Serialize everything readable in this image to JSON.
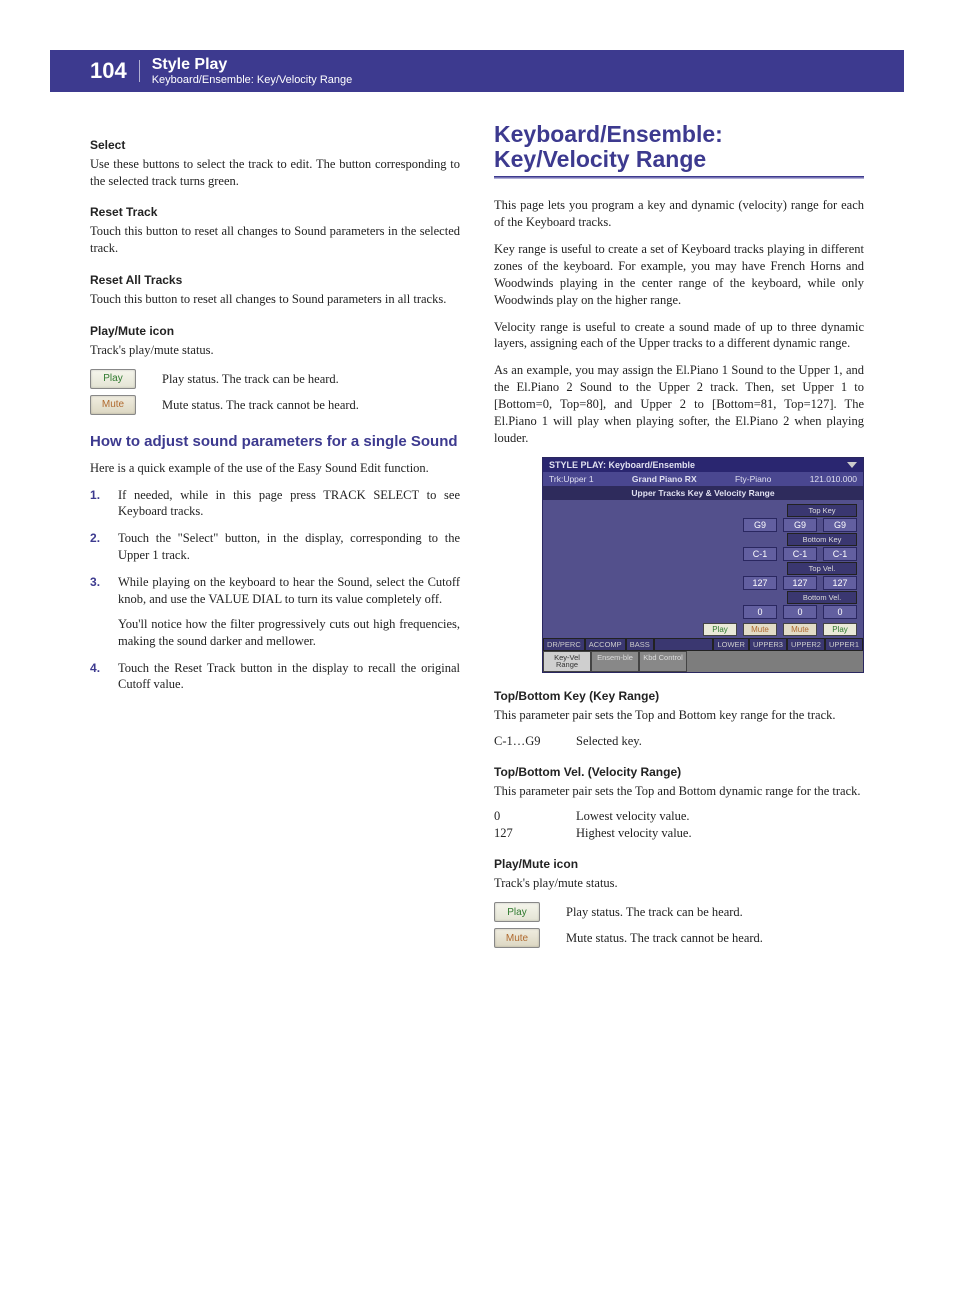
{
  "header": {
    "page_number": "104",
    "title": "Style Play",
    "subtitle": "Keyboard/Ensemble: Key/Velocity Range"
  },
  "left": {
    "select_head": "Select",
    "select_body": "Use these buttons to select the track to edit. The button corresponding to the selected track turns green.",
    "reset_track_head": "Reset Track",
    "reset_track_body": "Touch this button to reset all changes to Sound parameters in the selected track.",
    "reset_all_head": "Reset All Tracks",
    "reset_all_body": "Touch this button to reset all changes to Sound parameters in all tracks.",
    "pm_head": "Play/Mute icon",
    "pm_body": "Track's play/mute status.",
    "play_label": "Play",
    "play_desc": "Play status. The track can be heard.",
    "mute_label": "Mute",
    "mute_desc": "Mute status. The track cannot be heard.",
    "howto_head": "How to adjust sound parameters for a single Sound",
    "howto_intro": "Here is a quick example of the use of the Easy Sound Edit function.",
    "steps": [
      "If needed, while in this page press TRACK SELECT to see Keyboard tracks.",
      "Touch the \"Select\" button, in the display, corresponding to the Upper 1 track.",
      "While playing on the keyboard to hear the Sound, select the Cutoff knob, and use the VALUE DIAL to turn its value completely off.",
      "Touch the Reset Track button in the display to recall the original Cutoff value."
    ],
    "step3_sub": "You'll notice how the filter progressively cuts out high frequencies, making the sound darker and mellower."
  },
  "right": {
    "title": "Keyboard/Ensemble: Key/Velocity Range",
    "p1": "This page lets you program a key and dynamic (velocity) range for each of the Keyboard tracks.",
    "p2": "Key range is useful to create a set of Keyboard tracks playing in different zones of the keyboard. For example, you may have French Horns and Woodwinds playing in the center range of the keyboard, while only Woodwinds play on the higher range.",
    "p3": "Velocity range is useful to create a sound made of up to three dynamic layers, assigning each of the Upper tracks to a different dynamic range.",
    "p4": "As an example, you may assign the El.Piano 1 Sound to the Upper 1, and the El.Piano 2 Sound to the Upper 2 track. Then, set Upper 1 to [Bottom=0, Top=80], and Upper 2 to [Bottom=81, Top=127]. The El.Piano 1 will play when playing softer, the El.Piano 2 when playing louder.",
    "tbkey_head": "Top/Bottom Key (Key Range)",
    "tbkey_body": "This parameter pair sets the Top and Bottom key range for the track.",
    "tbkey_param_k": "C-1…G9",
    "tbkey_param_v": "Selected key.",
    "tbvel_head": "Top/Bottom Vel. (Velocity Range)",
    "tbvel_body": "This parameter pair sets the Top and Bottom dynamic range for the track.",
    "tbvel_p0_k": "0",
    "tbvel_p0_v": "Lowest velocity value.",
    "tbvel_p1_k": "127",
    "tbvel_p1_v": "Highest velocity value.",
    "pm_head": "Play/Mute icon",
    "pm_body": "Track's play/mute status.",
    "play_label": "Play",
    "play_desc": "Play status. The track can be heard.",
    "mute_label": "Mute",
    "mute_desc": "Mute status. The track cannot be heard."
  },
  "screenshot": {
    "titlebar": "STYLE PLAY: Keyboard/Ensemble",
    "trk": "Trk:Upper 1",
    "sound": "Grand Piano RX",
    "fty": "Fty-Piano",
    "code": "121.010.000",
    "section": "Upper Tracks Key & Velocity Range",
    "labels": {
      "topkey": "Top Key",
      "botkey": "Bottom Key",
      "topvel": "Top Vel.",
      "botvel": "Bottom Vel."
    },
    "cols": [
      {
        "topkey": "G9",
        "botkey": "C-1",
        "topvel": "127",
        "botvel": "0",
        "pm": "Play",
        "track": "UPPER3"
      },
      {
        "topkey": "G9",
        "botkey": "C-1",
        "topvel": "127",
        "botvel": "0",
        "pm": "Mute",
        "track": "UPPER2"
      },
      {
        "topkey": "G9",
        "botkey": "C-1",
        "topvel": "127",
        "botvel": "0",
        "pm": "Mute",
        "track": "UPPER1_b"
      },
      {
        "pm": "Play",
        "track": "UPPER1"
      }
    ],
    "bottom_labels": [
      "DR/PERC",
      "ACCOMP",
      "BASS",
      "",
      "LOWER",
      "UPPER3",
      "UPPER2",
      "UPPER1"
    ],
    "tabs": [
      "Key-Vel Range",
      "Ensem-ble",
      "Kbd Control"
    ]
  }
}
